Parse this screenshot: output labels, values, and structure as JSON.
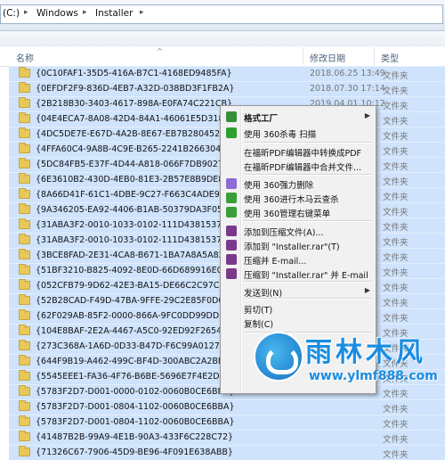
{
  "address": {
    "drive": "(C:)",
    "crumbs": [
      "Windows",
      "Installer"
    ]
  },
  "columns": {
    "name": "名称",
    "date": "修改日期",
    "type": "类型"
  },
  "rows": [
    {
      "name": "{0C10FAF1-35D5-416A-B7C1-4168ED9485FA}",
      "date": "2018.06.25 13:49",
      "type": "文件夹"
    },
    {
      "name": "{0EFDF2F9-836D-4EB7-A32D-038BD3F1FB2A}",
      "date": "2018.07.30 17:14",
      "type": "文件夹"
    },
    {
      "name": "{2B218B30-3403-4617-898A-E0FA74C221CB}",
      "date": "2019.04.01 10:12",
      "type": "文件夹"
    },
    {
      "name": "{04E4ECA7-8A08-42D4-84A1-46061E5D318B}",
      "date": "",
      "type": "文件夹"
    },
    {
      "name": "{4DC5DE7E-E67D-4A2B-8E67-EB7B28045247}",
      "date": "",
      "type": "文件夹"
    },
    {
      "name": "{4FFA60C4-9A8B-4C9E-B265-2241B266304C}",
      "date": "",
      "type": "文件夹"
    },
    {
      "name": "{5DC84FB5-E37F-4D44-A818-066F7DB9027E}",
      "date": "",
      "type": "文件夹"
    },
    {
      "name": "{6E3610B2-430D-4EB0-81E3-2B57E8B9DE8D}",
      "date": "",
      "type": "文件夹"
    },
    {
      "name": "{8A66D41F-61C1-4DBE-9C27-F663C4ADE9A8}",
      "date": "",
      "type": "文件夹"
    },
    {
      "name": "{9A346205-EA92-4406-B1AB-50379DA3F057}",
      "date": "",
      "type": "文件夹"
    },
    {
      "name": "{31ABA3F2-0010-1033-0102-111D43815377}",
      "date": "",
      "type": "文件夹"
    },
    {
      "name": "{31ABA3F2-0010-1033-0102-111D43815377}",
      "date": "",
      "type": "文件夹"
    },
    {
      "name": "{3BCE8FAD-2E31-4CA8-B671-1BA7A8A5A828}",
      "date": "",
      "type": "文件夹"
    },
    {
      "name": "{51BF3210-B825-4092-8E0D-66D689916E02}",
      "date": "",
      "type": "文件夹"
    },
    {
      "name": "{052CFB79-9D62-42E3-BA15-DE66C2C97C3E}",
      "date": "",
      "type": "文件夹"
    },
    {
      "name": "{52B28CAD-F49D-47BA-9FFE-29C2E85F0D0B}",
      "date": "",
      "type": "文件夹"
    },
    {
      "name": "{62F029AB-85F2-0000-866A-9FC0DD99DDBC}",
      "date": "",
      "type": "文件夹"
    },
    {
      "name": "{104E8BAF-2E2A-4467-A5C0-92ED92F26547}",
      "date": "",
      "type": "文件夹"
    },
    {
      "name": "{273C368A-1A6D-0D33-B47D-F6C99A0127EB}",
      "date": "",
      "type": "文件夹"
    },
    {
      "name": "{644F9B19-A462-499C-BF4D-300ABC2A2BB1}",
      "date": "",
      "type": "文件夹"
    },
    {
      "name": "{5545EEE1-FA36-4F76-B6BE-5696E7F4E2D6}",
      "date": "",
      "type": "文件夹"
    },
    {
      "name": "{5783F2D7-D001-0000-0102-0060B0CE6BBA}",
      "date": "",
      "type": "文件夹"
    },
    {
      "name": "{5783F2D7-D001-0804-1102-0060B0CE6BBA}",
      "date": "",
      "type": "文件夹"
    },
    {
      "name": "{5783F2D7-D001-0804-1102-0060B0CE6BBA}",
      "date": "",
      "type": "文件夹"
    },
    {
      "name": "{41487B2B-99A9-4E1B-90A3-433F6C228C72}",
      "date": "",
      "type": "文件夹"
    },
    {
      "name": "{71326C67-7906-45D9-BE96-4F091E638ABB}",
      "date": "",
      "type": "文件夹"
    }
  ],
  "menu": {
    "items": [
      {
        "label": "格式工厂",
        "icon": "format-factory-icon",
        "color": "#3a8f3a",
        "bold": true,
        "submenu": true
      },
      {
        "label": "使用 360杀毒 扫描",
        "icon": "shield-360-icon",
        "color": "#2f9f2f"
      },
      {
        "label": "在福昕PDF编辑器中转换成PDF",
        "icon": "",
        "color": ""
      },
      {
        "label": "在福昕PDF编辑器中合并文件...",
        "icon": "",
        "color": ""
      },
      {
        "label": "使用 360强力删除",
        "icon": "trash-360-icon",
        "color": "#8c6bd6"
      },
      {
        "label": "使用 360进行木马云查杀",
        "icon": "shield-scan-icon",
        "color": "#3a9f3a"
      },
      {
        "label": "使用 360管理右键菜单",
        "icon": "menu-manage-icon",
        "color": "#3a9f3a"
      },
      {
        "label": "添加到压缩文件(A)...",
        "icon": "winrar-icon",
        "color": "#7a3a8c"
      },
      {
        "label": "添加到 \"Installer.rar\"(T)",
        "icon": "winrar-icon",
        "color": "#7a3a8c"
      },
      {
        "label": "压缩并 E-mail...",
        "icon": "winrar-icon",
        "color": "#7a3a8c"
      },
      {
        "label": "压缩到 \"Installer.rar\" 并 E-mail",
        "icon": "winrar-icon",
        "color": "#7a3a8c"
      },
      {
        "label": "发送到(N)",
        "icon": "",
        "color": "",
        "submenu": true
      },
      {
        "label": "剪切(T)",
        "icon": "",
        "color": ""
      },
      {
        "label": "复制(C)",
        "icon": "",
        "color": ""
      }
    ]
  },
  "watermark": {
    "title": "雨林木风",
    "url": "www.ylmf888.com"
  }
}
